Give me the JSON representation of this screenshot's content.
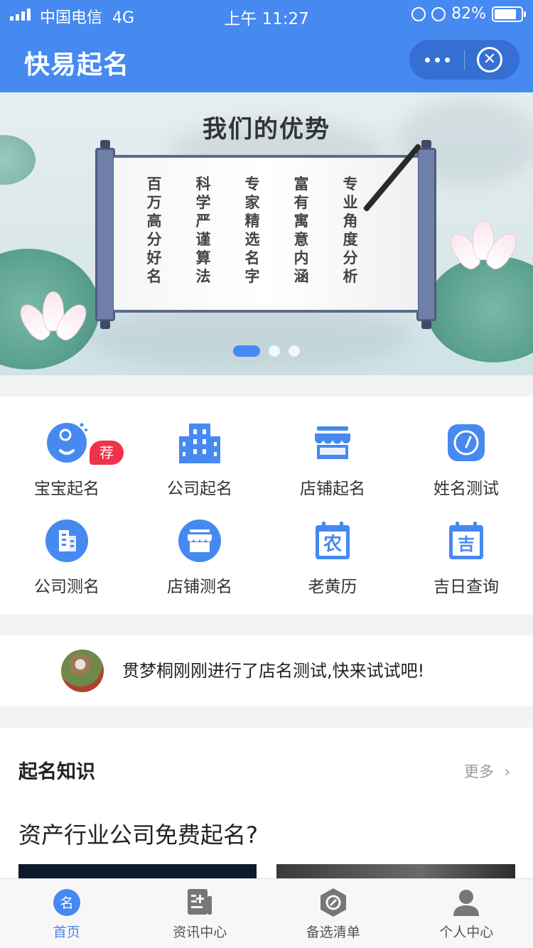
{
  "status_bar": {
    "carrier": "中国电信",
    "network": "4G",
    "time": "上午 11:27",
    "battery": "82%",
    "battery_level": 0.82
  },
  "app": {
    "title": "快易起名"
  },
  "banner": {
    "headline": "我们的优势",
    "columns": [
      "百万高分好名",
      "科学严谨算法",
      "专家精选名字",
      "富有寓意内涵",
      "专业角度分析"
    ],
    "slide_count": 3,
    "active_slide": 1
  },
  "services": [
    {
      "label": "宝宝起名",
      "icon": "baby-face-icon",
      "tag": "荐"
    },
    {
      "label": "公司起名",
      "icon": "office-building-icon"
    },
    {
      "label": "店铺起名",
      "icon": "storefront-icon"
    },
    {
      "label": "姓名测试",
      "icon": "gauge-icon"
    },
    {
      "label": "公司测名",
      "icon": "building-circle-icon"
    },
    {
      "label": "店铺测名",
      "icon": "store-circle-icon"
    },
    {
      "label": "老黄历",
      "icon": "calendar-nong-icon",
      "glyph": "农"
    },
    {
      "label": "吉日查询",
      "icon": "calendar-ji-icon",
      "glyph": "吉"
    }
  ],
  "notice": {
    "text": "贯梦桐刚刚进行了店名测试,快来试试吧!"
  },
  "knowledge": {
    "section_title": "起名知识",
    "more_label": "更多",
    "article_title": "资产行业公司免费起名?"
  },
  "tabbar": {
    "tabs": [
      {
        "label": "首页",
        "icon": "home-name-icon",
        "glyph": "名",
        "active": true
      },
      {
        "label": "资讯中心",
        "icon": "news-doc-icon",
        "active": false
      },
      {
        "label": "备选清单",
        "icon": "link-hexagon-icon",
        "active": false
      },
      {
        "label": "个人中心",
        "icon": "person-icon",
        "active": false
      }
    ]
  },
  "colors": {
    "primary": "#4689f0",
    "tag_red": "#f0334b"
  }
}
